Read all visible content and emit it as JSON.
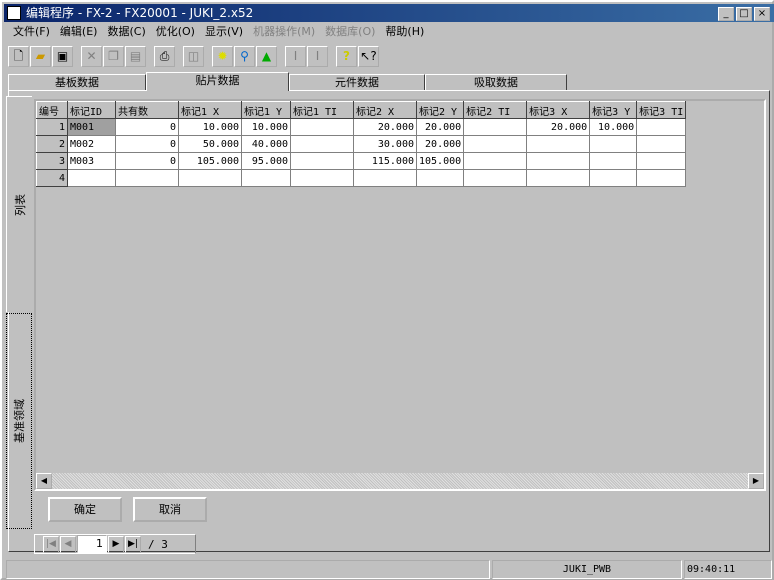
{
  "window": {
    "title": "编辑程序 - FX-2 - FX20001 - JUKI_2.x52",
    "min": "_",
    "max": "□",
    "close": "×"
  },
  "menu": [
    {
      "label": "文件(F)",
      "disabled": false
    },
    {
      "label": "编辑(E)",
      "disabled": false
    },
    {
      "label": "数据(C)",
      "disabled": false
    },
    {
      "label": "优化(O)",
      "disabled": false
    },
    {
      "label": "显示(V)",
      "disabled": false
    },
    {
      "label": "机器操作(M)",
      "disabled": true
    },
    {
      "label": "数据库(O)",
      "disabled": true
    },
    {
      "label": "帮助(H)",
      "disabled": false
    }
  ],
  "tabs": [
    "基板数据",
    "贴片数据",
    "元件数据",
    "吸取数据"
  ],
  "active_tab": "贴片数据",
  "side_tabs": [
    "列表",
    "基准领域"
  ],
  "grid": {
    "headers": [
      "编号",
      "标记ID",
      "共有数",
      "标记1 X",
      "标记1 Y",
      "标记1 TI",
      "标记2 X",
      "标记2 Y",
      "标记2 TI",
      "标记3 X",
      "标记3 Y",
      "标记3 TI"
    ],
    "rows": [
      [
        "1",
        "M001",
        "0",
        "10.000",
        "10.000",
        "",
        "20.000",
        "20.000",
        "",
        "20.000",
        "10.000",
        ""
      ],
      [
        "2",
        "M002",
        "0",
        "50.000",
        "40.000",
        "",
        "30.000",
        "20.000",
        "",
        "",
        "",
        ""
      ],
      [
        "3",
        "M003",
        "0",
        "105.000",
        "95.000",
        "",
        "115.000",
        "105.000",
        "",
        "",
        "",
        ""
      ],
      [
        "4",
        "",
        "",
        "",
        "",
        "",
        "",
        "",
        "",
        "",
        "",
        ""
      ]
    ]
  },
  "buttons": {
    "ok": "确定",
    "cancel": "取消"
  },
  "pager": {
    "current": "1",
    "total": "/ 3"
  },
  "status": {
    "left": "",
    "middle": "JUKI_PWB",
    "time": "09:40:11"
  }
}
